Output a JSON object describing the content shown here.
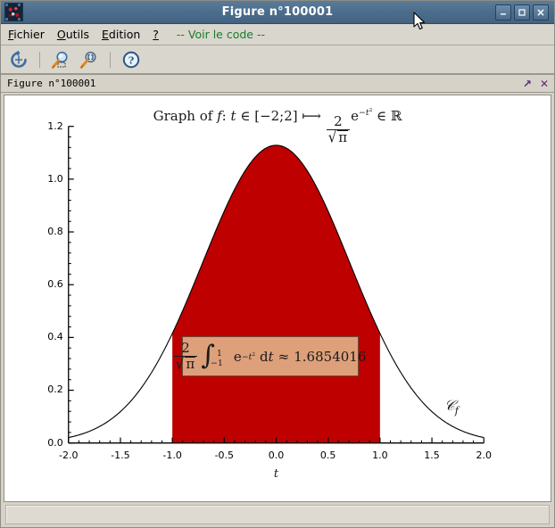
{
  "window": {
    "title": "Figure n°100001",
    "icon": "scilab-icon",
    "controls": [
      {
        "name": "minimize-button",
        "glyph": "–"
      },
      {
        "name": "maximize-button",
        "glyph": "□"
      },
      {
        "name": "close-button",
        "glyph": "✕"
      }
    ]
  },
  "menubar": {
    "items": [
      {
        "name": "menu-fichier",
        "mnemonic": "F",
        "rest": "ichier"
      },
      {
        "name": "menu-outils",
        "mnemonic": "O",
        "rest": "utils"
      },
      {
        "name": "menu-edition",
        "mnemonic": "E",
        "rest": "dition"
      },
      {
        "name": "menu-help",
        "mnemonic": "?",
        "rest": ""
      }
    ],
    "code_link": "-- Voir le code --",
    "code_link_color": "#1a7a2e"
  },
  "toolbar": {
    "buttons": [
      {
        "name": "reload-icon",
        "title": "Recharger"
      },
      {
        "name": "zoom-box-icon",
        "title": "Zoom zone"
      },
      {
        "name": "zoom-reset-icon",
        "title": "Zoom original"
      },
      {
        "name": "help-icon",
        "title": "Aide"
      }
    ]
  },
  "tabstrip": {
    "label": "Figure n°100001",
    "undock_icon": "↗",
    "close_icon": "✕",
    "icon_color": "#5b2a7a"
  },
  "statusbar": {
    "text": ""
  },
  "chart_data": {
    "type": "area",
    "title": "Graph of f : t ∈ [−2;2] ⟼ (2/√π)·e^(−t²) ∈ ℝ",
    "title_parts": {
      "lead": "Graph of",
      "fn": "f",
      "colon": ":",
      "var": "t",
      "in1": "∈",
      "domain": "[−2;2]",
      "maps": "⟼",
      "num": "2",
      "den_sqrt": "√",
      "den_pi": "π",
      "e": "e",
      "exp_minus": "−",
      "exp_t": "t",
      "exp_two": "2",
      "in2": "∈",
      "codomain": "ℝ"
    },
    "xlabel": "t",
    "ylabel": "",
    "xlim": [
      -2.0,
      2.0
    ],
    "ylim": [
      0.0,
      1.2
    ],
    "xticks": [
      "-2.0",
      "-1.5",
      "-1.0",
      "-0.5",
      "0.0",
      "0.5",
      "1.0",
      "1.5",
      "2.0"
    ],
    "xtick_values": [
      -2.0,
      -1.5,
      -1.0,
      -0.5,
      0.0,
      0.5,
      1.0,
      1.5,
      2.0
    ],
    "yticks": [
      "0.0",
      "0.2",
      "0.4",
      "0.6",
      "0.8",
      "1.0",
      "1.2"
    ],
    "ytick_values": [
      0.0,
      0.2,
      0.4,
      0.6,
      0.8,
      1.0,
      1.2
    ],
    "minor_ticks_per_interval": 4,
    "grid": false,
    "legend": false,
    "curve_label": "𝒞f",
    "curve_color": "#000000",
    "fill_color": "#be0000",
    "fill_range": [
      -1.0,
      1.0
    ],
    "function": "f(t) = (2/sqrt(pi)) * exp(-t^2)",
    "peak_value": 1.1284,
    "x": [
      -2.0,
      -1.9,
      -1.8,
      -1.7,
      -1.6,
      -1.5,
      -1.4,
      -1.3,
      -1.2,
      -1.1,
      -1.0,
      -0.9,
      -0.8,
      -0.7,
      -0.6,
      -0.5,
      -0.4,
      -0.3,
      -0.2,
      -0.1,
      0.0,
      0.1,
      0.2,
      0.3,
      0.4,
      0.5,
      0.6,
      0.7,
      0.8,
      0.9,
      1.0,
      1.1,
      1.2,
      1.3,
      1.4,
      1.5,
      1.6,
      1.7,
      1.8,
      1.9,
      2.0
    ],
    "y": [
      0.0207,
      0.0303,
      0.0437,
      0.0621,
      0.0871,
      0.1189,
      0.159,
      0.2085,
      0.2673,
      0.3365,
      0.4151,
      0.502,
      0.595,
      0.6913,
      0.7872,
      0.8788,
      0.9615,
      1.0313,
      1.0841,
      1.1172,
      1.1284,
      1.1172,
      1.0841,
      1.0313,
      0.9615,
      0.8788,
      0.7872,
      0.6913,
      0.595,
      0.502,
      0.4151,
      0.3365,
      0.2673,
      0.2085,
      0.159,
      0.1189,
      0.0871,
      0.0621,
      0.0437,
      0.0303,
      0.0207
    ],
    "annotation": {
      "text": "(2/√π) ∫ from −1 to 1 of e^(−t²) dt ≈ 1.6854016",
      "parts": {
        "num": "2",
        "sqrt": "√",
        "pi": "π",
        "int": "∫",
        "upper": "1",
        "lower": "−1",
        "e": "e",
        "exp_minus": "−",
        "exp_t": "t",
        "exp_two": "2",
        "dt_d": "d",
        "dt_t": "t",
        "approx": "≈",
        "value": "1.6854016"
      },
      "bg_color": "#dda07a",
      "border_color": "#6b4a38"
    }
  }
}
